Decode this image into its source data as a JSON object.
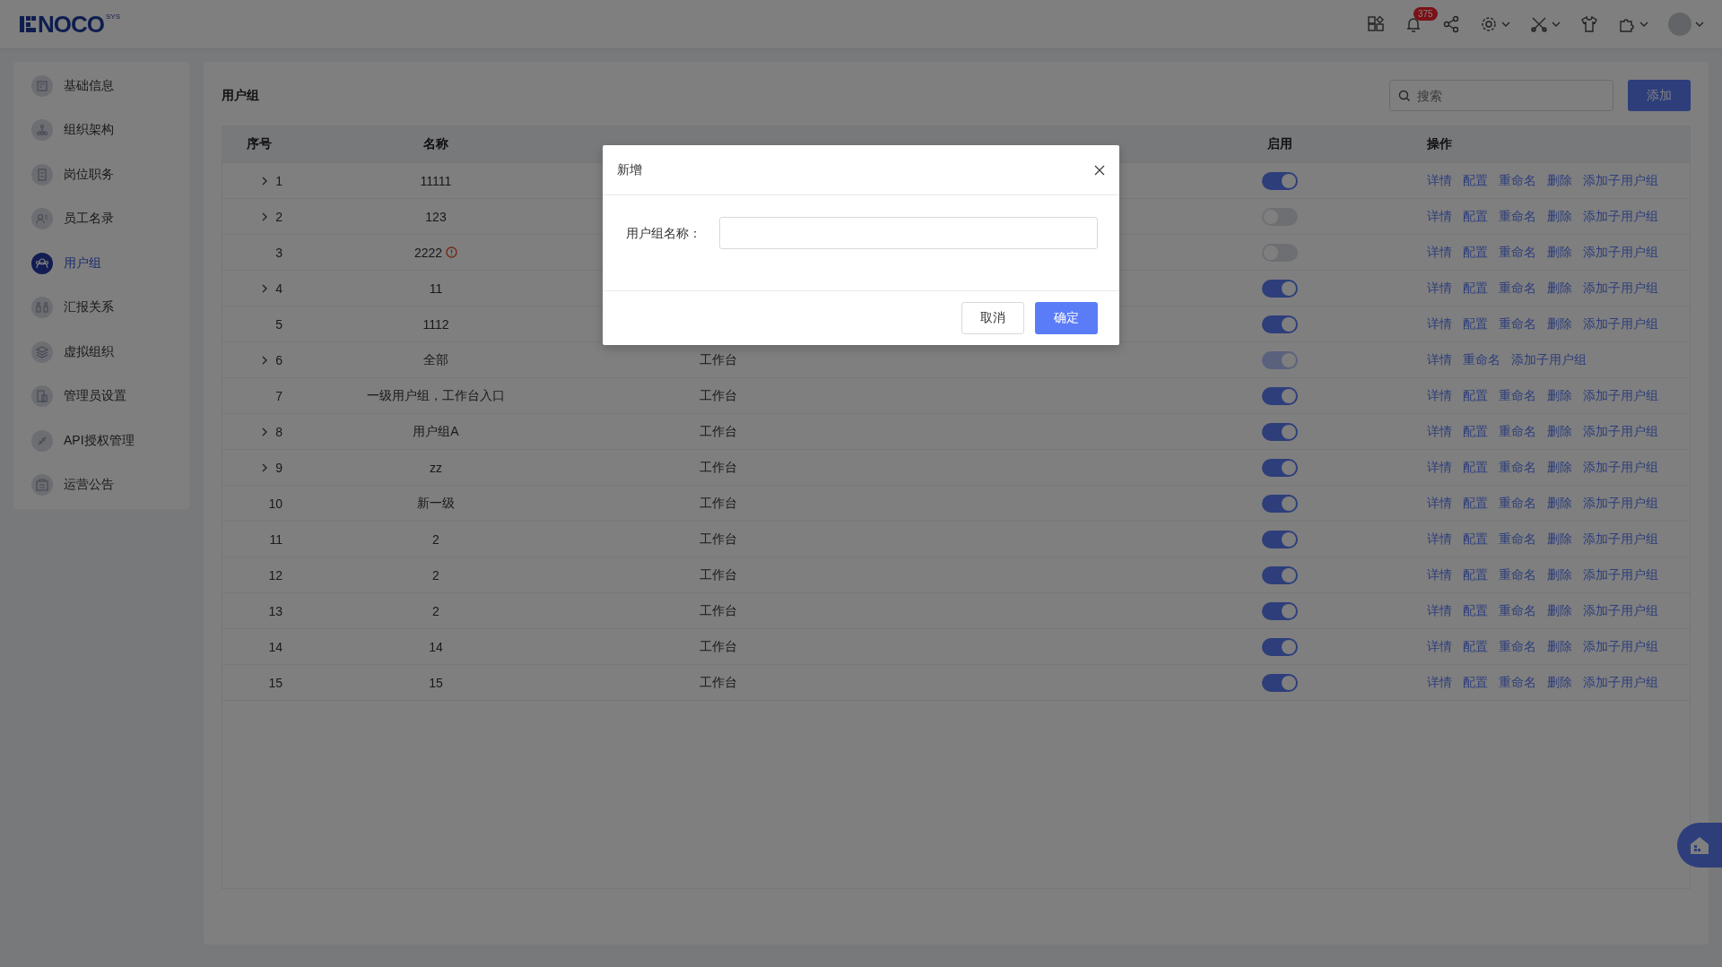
{
  "header": {
    "logo": "NOCO",
    "logo_sup": "SYS",
    "notification_count": "375"
  },
  "sidebar": {
    "items": [
      {
        "label": "基础信息",
        "selected": false
      },
      {
        "label": "组织架构",
        "selected": false
      },
      {
        "label": "岗位职务",
        "selected": false
      },
      {
        "label": "员工名录",
        "selected": false
      },
      {
        "label": "用户组",
        "selected": true
      },
      {
        "label": "汇报关系",
        "selected": false
      },
      {
        "label": "虚拟组织",
        "selected": false
      },
      {
        "label": "管理员设置",
        "selected": false
      },
      {
        "label": "API授权管理",
        "selected": false
      },
      {
        "label": "运营公告",
        "selected": false
      }
    ]
  },
  "main": {
    "title": "用户组",
    "search": {
      "placeholder": "搜索"
    },
    "add_button": "添加"
  },
  "table": {
    "columns": [
      {
        "kind": "label",
        "label": "序号"
      },
      {
        "kind": "label",
        "label": "名称"
      },
      {
        "kind": "covered"
      },
      {
        "kind": "covered"
      },
      {
        "kind": "label",
        "label": "启用"
      },
      {
        "kind": "label",
        "label": "操作"
      }
    ],
    "rows": [
      {
        "index": "1",
        "name": "11111",
        "expandable": true,
        "warning": false,
        "enabled": true,
        "disabled": false,
        "actions": [
          "详情",
          "配置",
          "重命名",
          "删除",
          "添加子用户组"
        ]
      },
      {
        "index": "2",
        "name": "123",
        "expandable": true,
        "warning": false,
        "enabled": false,
        "disabled": false,
        "actions": [
          "详情",
          "配置",
          "重命名",
          "删除",
          "添加子用户组"
        ]
      },
      {
        "index": "3",
        "name": "2222",
        "expandable": false,
        "warning": true,
        "enabled": false,
        "disabled": false,
        "actions": [
          "详情",
          "配置",
          "重命名",
          "删除",
          "添加子用户组"
        ]
      },
      {
        "index": "4",
        "name": "11",
        "expandable": true,
        "warning": false,
        "enabled": true,
        "disabled": false,
        "actions": [
          "详情",
          "配置",
          "重命名",
          "删除",
          "添加子用户组"
        ]
      },
      {
        "index": "5",
        "name": "1112",
        "expandable": false,
        "warning": false,
        "enabled": true,
        "disabled": false,
        "actions": [
          "详情",
          "配置",
          "重命名",
          "删除",
          "添加子用户组"
        ]
      },
      {
        "index": "6",
        "name": "全部",
        "expandable": true,
        "warning": false,
        "entry": "工作台",
        "enabled": true,
        "disabled": true,
        "actions": [
          "详情",
          "重命名",
          "添加子用户组"
        ]
      },
      {
        "index": "7",
        "name": "一级用户组，工作台入口",
        "expandable": false,
        "warning": false,
        "entry": "工作台",
        "enabled": true,
        "disabled": false,
        "actions": [
          "详情",
          "配置",
          "重命名",
          "删除",
          "添加子用户组"
        ]
      },
      {
        "index": "8",
        "name": "用户组A",
        "expandable": true,
        "warning": false,
        "entry": "工作台",
        "enabled": true,
        "disabled": false,
        "actions": [
          "详情",
          "配置",
          "重命名",
          "删除",
          "添加子用户组"
        ]
      },
      {
        "index": "9",
        "name": "zz",
        "expandable": true,
        "warning": false,
        "entry": "工作台",
        "enabled": true,
        "disabled": false,
        "actions": [
          "详情",
          "配置",
          "重命名",
          "删除",
          "添加子用户组"
        ]
      },
      {
        "index": "10",
        "name": "新一级",
        "expandable": false,
        "warning": false,
        "entry": "工作台",
        "enabled": true,
        "disabled": false,
        "actions": [
          "详情",
          "配置",
          "重命名",
          "删除",
          "添加子用户组"
        ]
      },
      {
        "index": "11",
        "name": "2",
        "expandable": false,
        "warning": false,
        "entry": "工作台",
        "enabled": true,
        "disabled": false,
        "actions": [
          "详情",
          "配置",
          "重命名",
          "删除",
          "添加子用户组"
        ]
      },
      {
        "index": "12",
        "name": "2",
        "expandable": false,
        "warning": false,
        "entry": "工作台",
        "enabled": true,
        "disabled": false,
        "actions": [
          "详情",
          "配置",
          "重命名",
          "删除",
          "添加子用户组"
        ]
      },
      {
        "index": "13",
        "name": "2",
        "expandable": false,
        "warning": false,
        "entry": "工作台",
        "enabled": true,
        "disabled": false,
        "actions": [
          "详情",
          "配置",
          "重命名",
          "删除",
          "添加子用户组"
        ]
      },
      {
        "index": "14",
        "name": "14",
        "expandable": false,
        "warning": false,
        "entry": "工作台",
        "enabled": true,
        "disabled": false,
        "actions": [
          "详情",
          "配置",
          "重命名",
          "删除",
          "添加子用户组"
        ]
      },
      {
        "index": "15",
        "name": "15",
        "expandable": false,
        "warning": false,
        "entry": "工作台",
        "enabled": true,
        "disabled": false,
        "actions": [
          "详情",
          "配置",
          "重命名",
          "删除",
          "添加子用户组"
        ]
      }
    ]
  },
  "dialog": {
    "title": "新增",
    "field_label": "用户组名称：",
    "cancel": "取消",
    "confirm": "确定"
  }
}
